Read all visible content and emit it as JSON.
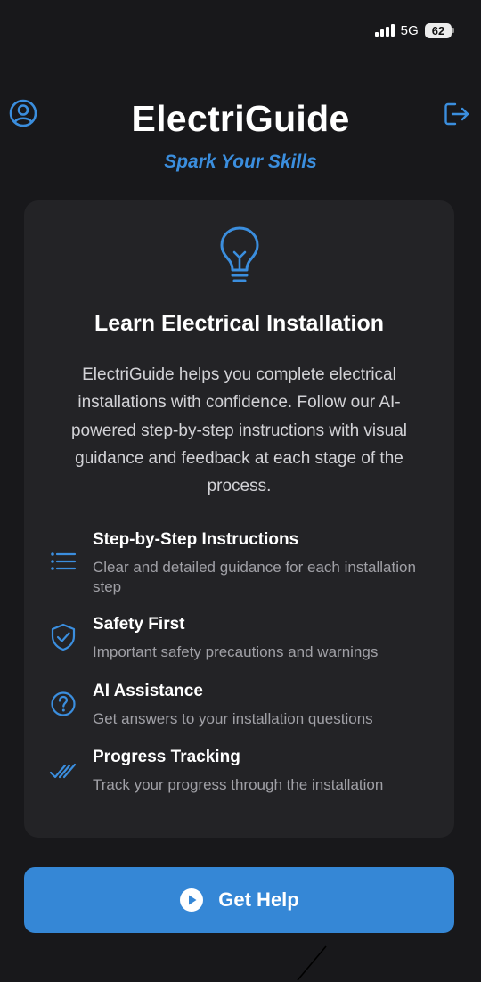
{
  "status_bar": {
    "network": "5G",
    "battery": "62"
  },
  "header": {
    "title": "ElectriGuide",
    "tagline": "Spark Your Skills",
    "profile_icon": "person-circle-icon",
    "logout_icon": "logout-arrow-icon"
  },
  "card": {
    "icon": "lightbulb-icon",
    "heading": "Learn Electrical Installation",
    "description": "ElectriGuide helps you complete electrical installations with confidence. Follow our AI-powered step-by-step instructions with visual guidance and feedback at each stage of the process.",
    "features": [
      {
        "icon": "list-icon",
        "title": "Step-by-Step Instructions",
        "description": "Clear and detailed guidance for each installation step"
      },
      {
        "icon": "shield-check-icon",
        "title": "Safety First",
        "description": "Important safety precautions and warnings"
      },
      {
        "icon": "question-circle-icon",
        "title": "AI Assistance",
        "description": "Get answers to your installation questions"
      },
      {
        "icon": "double-check-icon",
        "title": "Progress Tracking",
        "description": "Track your progress through the installation"
      }
    ]
  },
  "cta": {
    "label": "Get Help",
    "icon": "play-circle-icon"
  },
  "colors": {
    "background": "#18181b",
    "card": "#232326",
    "accent": "#3b8ede",
    "button": "#3587d6"
  }
}
